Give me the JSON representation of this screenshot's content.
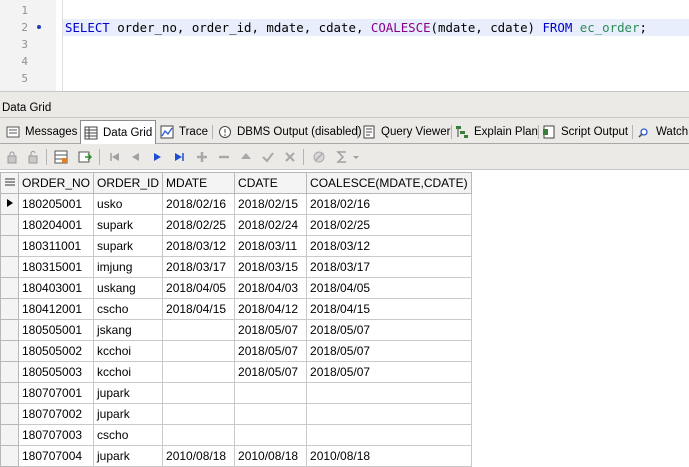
{
  "editor": {
    "line_numbers": [
      "1",
      "2",
      "3",
      "4",
      "5"
    ],
    "tokens": {
      "select": "SELECT",
      "columns": " order_no, order_id, mdate, cdate, ",
      "coalesce": "COALESCE",
      "args": "(mdate, cdate) ",
      "from": "FROM",
      "space": " ",
      "table": "ec_order",
      "end": ";"
    }
  },
  "panel": {
    "title": "Data Grid"
  },
  "tabs": [
    {
      "label": "Messages",
      "icon": "messages-icon"
    },
    {
      "label": "Data Grid",
      "icon": "grid-icon",
      "active": true
    },
    {
      "label": "Trace",
      "icon": "trace-icon"
    },
    {
      "label": "DBMS Output (disabled)",
      "icon": "dbms-output-icon"
    },
    {
      "label": "Query Viewer",
      "icon": "query-viewer-icon"
    },
    {
      "label": "Explain Plan",
      "icon": "explain-plan-icon"
    },
    {
      "label": "Script Output",
      "icon": "script-output-icon"
    },
    {
      "label": "Watch",
      "icon": "watch-icon"
    }
  ],
  "toolbar": {
    "icons": [
      "lock-icon",
      "unlock-icon",
      "grid-options-icon",
      "export-icon",
      "first-record-icon",
      "prior-record-icon",
      "next-record-icon",
      "last-record-icon",
      "insert-record-icon",
      "delete-record-icon",
      "edit-record-icon",
      "post-record-icon",
      "cancel-record-icon",
      "filter-icon",
      "sum-icon",
      "dropdown-icon"
    ]
  },
  "grid": {
    "columns": [
      "ORDER_NO",
      "ORDER_ID",
      "MDATE",
      "CDATE",
      "COALESCE(MDATE,CDATE)"
    ],
    "rows": [
      [
        "180205001",
        "usko",
        "2018/02/16",
        "2018/02/15",
        "2018/02/16"
      ],
      [
        "180204001",
        "supark",
        "2018/02/25",
        "2018/02/24",
        "2018/02/25"
      ],
      [
        "180311001",
        "supark",
        "2018/03/12",
        "2018/03/11",
        "2018/03/12"
      ],
      [
        "180315001",
        "imjung",
        "2018/03/17",
        "2018/03/15",
        "2018/03/17"
      ],
      [
        "180403001",
        "uskang",
        "2018/04/05",
        "2018/04/03",
        "2018/04/05"
      ],
      [
        "180412001",
        "cscho",
        "2018/04/15",
        "2018/04/12",
        "2018/04/15"
      ],
      [
        "180505001",
        "jskang",
        "",
        "2018/05/07",
        "2018/05/07"
      ],
      [
        "180505002",
        "kcchoi",
        "",
        "2018/05/07",
        "2018/05/07"
      ],
      [
        "180505003",
        "kcchoi",
        "",
        "2018/05/07",
        "2018/05/07"
      ],
      [
        "180707001",
        "jupark",
        "",
        "",
        ""
      ],
      [
        "180707002",
        "jupark",
        "",
        "",
        ""
      ],
      [
        "180707003",
        "cscho",
        "",
        "",
        ""
      ],
      [
        "180707004",
        "jupark",
        "2010/08/18",
        "2010/08/18",
        "2010/08/18"
      ]
    ],
    "current_row": 0
  },
  "colors": {
    "keyword": "#0000cc",
    "function": "#8b008b",
    "table": "#2e8b57",
    "line_highlight": "#e8eefb"
  }
}
